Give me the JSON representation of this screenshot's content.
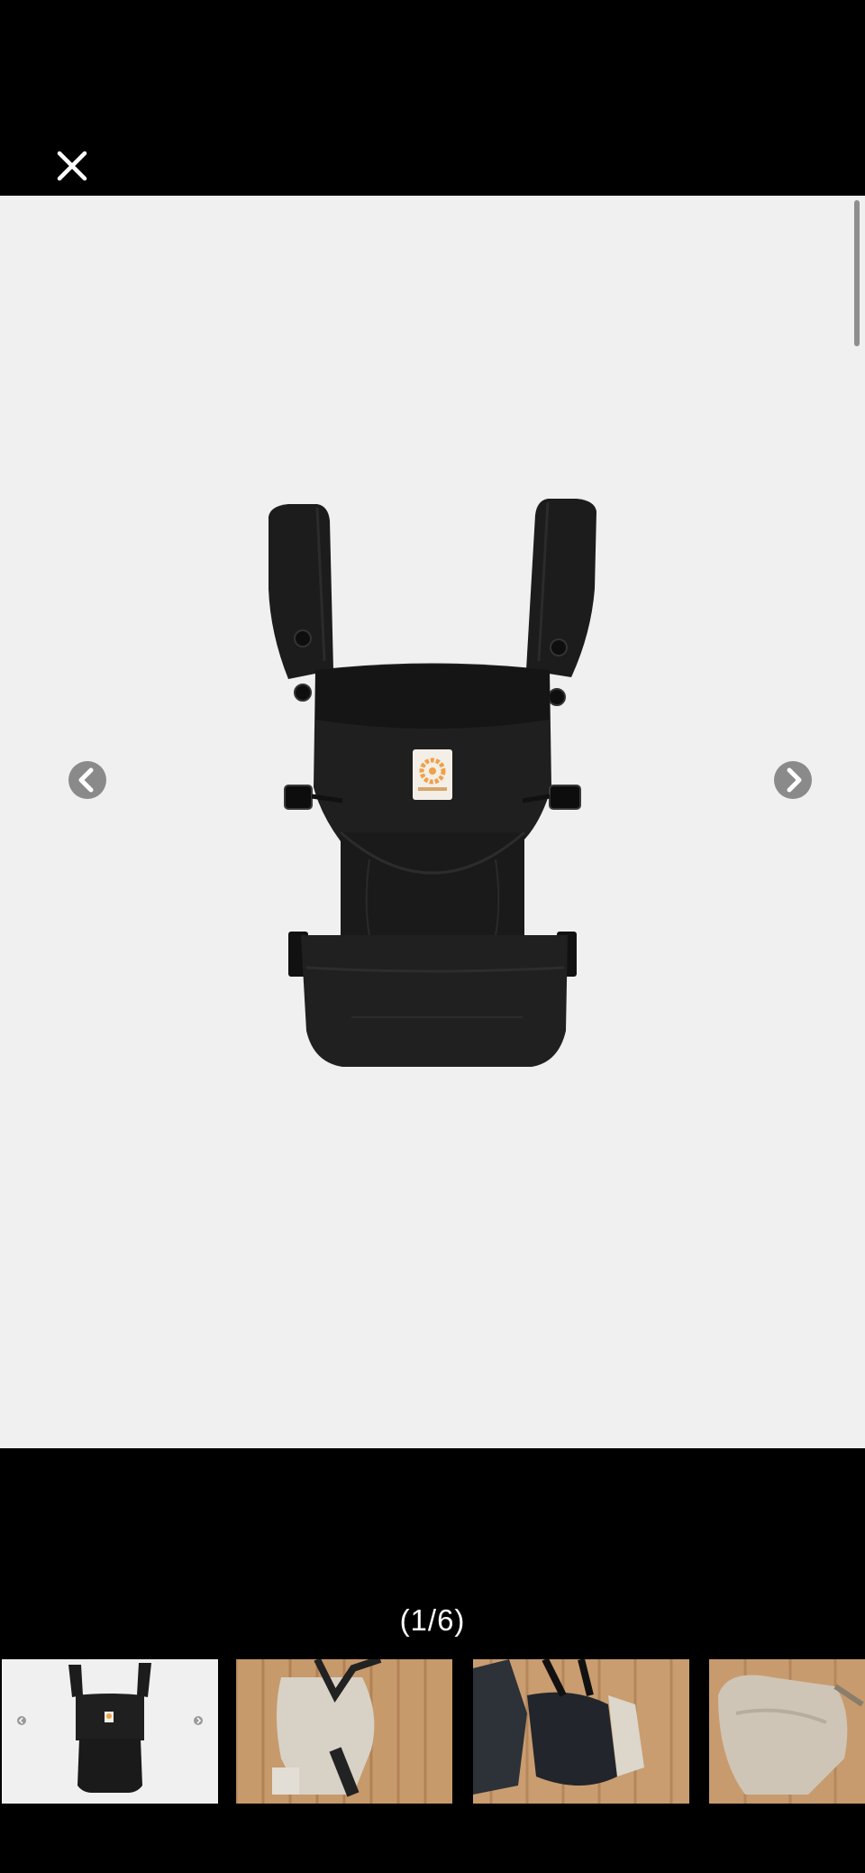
{
  "viewer": {
    "counter": "(1/6)",
    "current_index": 1,
    "total_images": 6
  },
  "icons": {
    "close": "close-icon",
    "prev": "chevron-left-icon",
    "next": "chevron-right-icon"
  },
  "colors": {
    "background": "#000000",
    "viewer_background": "#f1f0f0",
    "arrow": "#8a8a8a",
    "carrier": "#1c1c1c",
    "logo_orange": "#f0a04b"
  },
  "thumbnails": [
    {
      "label": "black-carrier-product-photo",
      "active": true
    },
    {
      "label": "carrier-on-wood-floor-photo-1",
      "active": false
    },
    {
      "label": "carrier-on-wood-floor-photo-2",
      "active": false
    },
    {
      "label": "carrier-on-wood-floor-photo-3",
      "active": false
    }
  ]
}
